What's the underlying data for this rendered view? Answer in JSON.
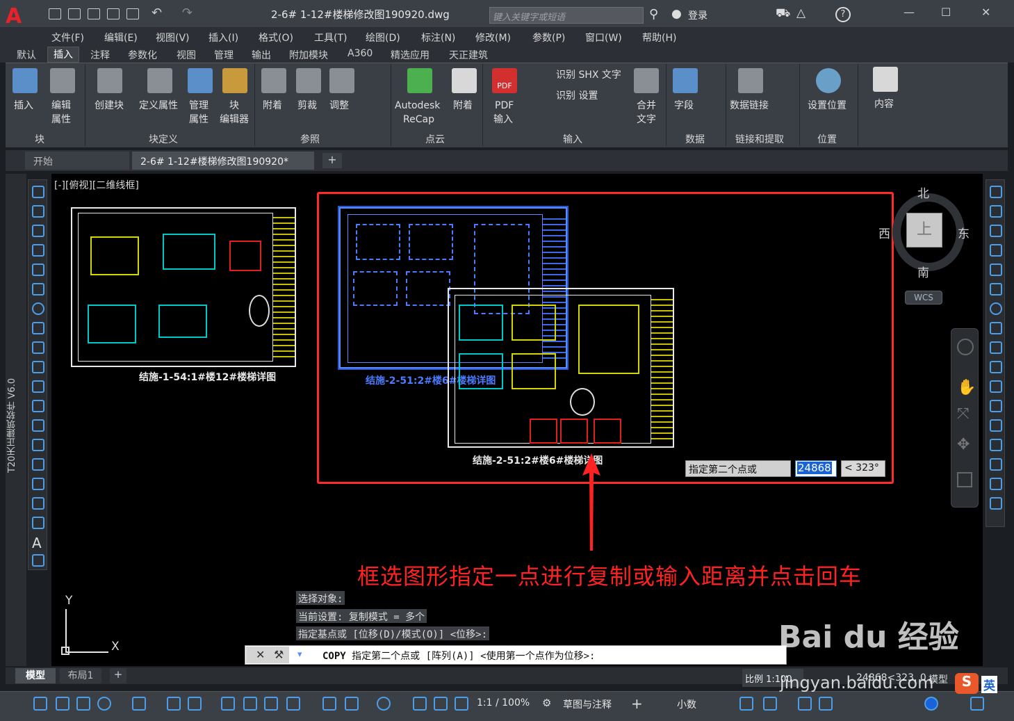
{
  "window": {
    "title": "2-6# 1-12#楼梯修改图190920.dwg",
    "search_placeholder": "键入关键字或短语",
    "login": "登录"
  },
  "menu": [
    "文件(F)",
    "编辑(E)",
    "视图(V)",
    "插入(I)",
    "格式(O)",
    "工具(T)",
    "绘图(D)",
    "标注(N)",
    "修改(M)",
    "参数(P)",
    "窗口(W)",
    "帮助(H)"
  ],
  "ribbon_tabs": [
    "默认",
    "插入",
    "注释",
    "参数化",
    "视图",
    "管理",
    "输出",
    "附加模块",
    "A360",
    "精选应用",
    "天正建筑"
  ],
  "ribbon_active_tab": "插入",
  "ribbon": {
    "insert": "插入",
    "edit_attr": "编辑",
    "edit_attr2": "属性",
    "create_block": "创建块",
    "define_attr": "定义属性",
    "manage_attr": "管理",
    "manage_attr2": "属性",
    "block_editor": "块",
    "block_editor2": "编辑器",
    "attach": "附着",
    "clip": "剪裁",
    "adjust": "调整",
    "recap": "Autodesk",
    "recap2": "ReCap",
    "attach2": "附着",
    "pdf": "PDF",
    "pdf_import": "PDF",
    "pdf_import2": "输入",
    "shx_recognize": "识别 SHX 文字",
    "recognize_settings": "识别 设置",
    "combine_text": "合并",
    "combine_text2": "文字",
    "field": "字段",
    "data_link": "数据链接",
    "set_location": "设置位置",
    "set_location2": "设置位置",
    "content": "内容"
  },
  "panels": [
    "块",
    "块定义",
    "参照",
    "点云",
    "输入",
    "数据",
    "链接和提取",
    "位置"
  ],
  "file_tabs": {
    "start": "开始",
    "doc": "2-6# 1-12#楼梯修改图190920*"
  },
  "side_label": "T20天正建筑软件 V6.0",
  "view_label": "[-][俯视][二维线框]",
  "drawings": {
    "left": "结施-1-54:1#楼12#楼梯详图",
    "blue": "结施-2-51:2#楼6#楼梯详图",
    "copy": "结施-2-51:2#楼6#楼梯详图"
  },
  "viewcube": {
    "north": "北",
    "south": "南",
    "west": "西",
    "east": "东",
    "top": "上",
    "wcs": "WCS"
  },
  "dynamic_input": {
    "prompt": "指定第二个点或",
    "value": "24868",
    "angle": "< 323°"
  },
  "annotation": "框选图形指定一点进行复制或输入距离并点击回车",
  "history": [
    "选择对象:",
    "当前设置:   复制模式 = 多个",
    "指定基点或 [位移(D)/模式(O)] <位移>:"
  ],
  "command": {
    "name": "COPY",
    "text": "指定第二个点或 [阵列(A)] <使用第一个点作为位移>:"
  },
  "ucs": {
    "y": "Y",
    "x": "X"
  },
  "layout_tabs": [
    "模型",
    "布局1"
  ],
  "status": {
    "scale": "比例 1:100",
    "coords": "24868<323, 0",
    "model": "模型",
    "zoom": "1:1 / 100%",
    "workspace": "草图与注释",
    "units": "小数"
  },
  "watermark": {
    "brand": "Bai du 经验",
    "url": "jingyan.baidu.com",
    "ime": "英"
  }
}
